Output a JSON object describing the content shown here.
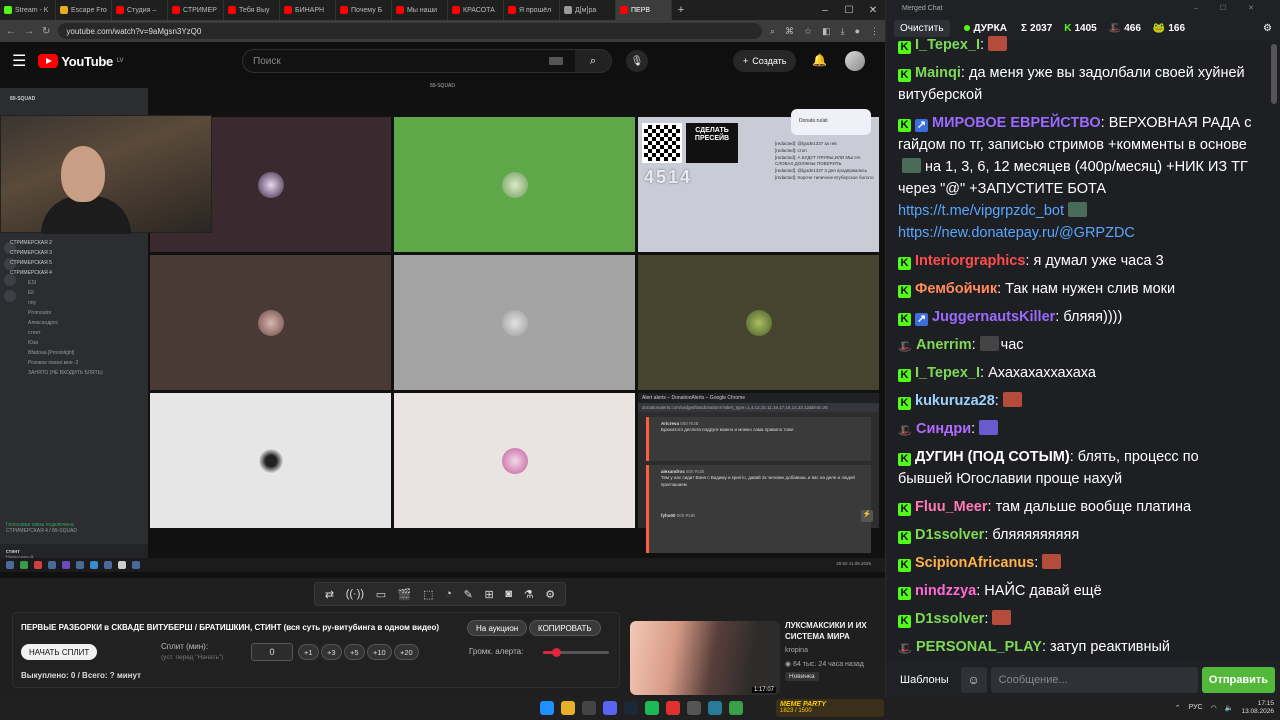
{
  "browser": {
    "tabs": [
      "Stream - K",
      "Escape Fro",
      "Студия –",
      "СТРИМЕР",
      "Тебя Выу",
      "БИНАРН",
      "Почему Б",
      "Мы наши",
      "КРАСОТА",
      "Я прошёл",
      "Д[м]ра",
      "ПЕРВ"
    ],
    "active_tab_index": 11,
    "url": "youtube.com/watch?v=9aMgsn3YzQ0"
  },
  "youtube": {
    "logo_text": "YouTube",
    "region": "LV",
    "search_placeholder": "Поиск",
    "create_label": "Создать"
  },
  "video": {
    "discord": {
      "server": "89-SQUAD",
      "channels": [
        "СТРИМЕРСКАЯ 2",
        "СТРИМЕРСКАЯ 3",
        "СТРИМЕРСКАЯ 5",
        "СТРИМЕРСКАЯ 4"
      ],
      "members": [
        "ESI",
        "Eli",
        "nny",
        "Promoutor",
        "Александрос",
        "стинт",
        "Юзи",
        "Bfadoaa [Prostolight]",
        "Розовое пиано мне -2",
        "ЗАНЯТО (НЕ ВХОДИТЬ БЛЯТЬ)"
      ],
      "status": "Голосовая связь подключена",
      "status_sub": "СТРИМЕРСКАЯ 4 / 89-SQUAD",
      "user": "стинт",
      "user_status": "Невидимый"
    },
    "tile_header": "89-SQUAD",
    "donation": {
      "donate_label": "Donate.ru/ati",
      "presave": "СДЕЛАТЬ ПРЕСЕЙВ",
      "counter": "4514",
      "chat_lines": [
        "[redacted]: @lgode1337 за гев",
        "[redacted]: стоп",
        "[redacted]: А БУДУТ ПРУФЫ,ИЛИ МЫ НА СЛОВАХ ДОЛЖНЫ ПОВЕРИТЬ",
        "[redacted]: @lgode1337 3 дня продержались",
        "[redacted]: Короче типичное втуберское болото"
      ]
    },
    "alerts": {
      "window_title": "Alert alerts – DonationAlerts – Google Chrome",
      "url": "donationalerts.com/widget/lastdonations?alert_type=1,4,13,15,11,19,17,16,14,33,12&limit=25",
      "messages": [
        {
          "name": "Aricreva",
          "amount": "500 RUB",
          "text": "Брюхатого деспота подруги можно и можно сама правило тоже"
        },
        {
          "name": "alexandros",
          "amount": "500 RUB",
          "text": "Тем у нас сидит Ваня с Вадиму и крипто, давай 2к человек добавишь и вас на деле и людей приглашаем"
        },
        {
          "name": "fyho00",
          "amount": "500 RUB",
          "text": ""
        }
      ]
    },
    "inner_clock": "20:52\n11.08.2026",
    "inner_lang": "ENG"
  },
  "controls": {
    "icons": [
      "shuffle-icon",
      "broadcast-icon",
      "card-icon",
      "clapper-icon",
      "frame-icon",
      "speed-icon",
      "pencil-icon",
      "add-screen-icon",
      "camera-icon",
      "flask-icon",
      "gear-icon"
    ]
  },
  "info_panel": {
    "title": "ПЕРВЫЕ РАЗБОРКИ в СКВАДЕ ВИТУБЕРШ / БРАТИШКИН, СТИНТ (вся суть ру-витубинга в одном видео)",
    "auction_button": "На аукцион",
    "copy_button": "КОПИРОВАТЬ",
    "split_button": "НАЧАТЬ СПЛИТ",
    "split_label": "Сплит (мин):",
    "split_hint": "(уст. перед \"Начать\")",
    "split_value": "0",
    "increments": [
      "+1",
      "+3",
      "+5",
      "+10",
      "+20"
    ],
    "alert_volume_label": "Громк. алерта:",
    "alert_volume": 0.2,
    "footer": "Выкуплено: 0 / Всего: ? минут"
  },
  "recommended": {
    "title": "ЛУКСМАКСИКИ И ИХ СИСТЕМА МИРА",
    "channel": "kropina",
    "stats": "64 тыс.  24 часа назад",
    "badge": "Новинка",
    "duration": "1:17:07"
  },
  "taskbar": {
    "meme_title": "MEME PARTY",
    "meme_sub": "1823 / 1500",
    "lang": "РУС",
    "time": "17:15",
    "date": "13.08.2026"
  },
  "chat": {
    "window_title": "Merged Chat",
    "clear_label": "Очистить",
    "live_name": "ДУРКА",
    "stats": [
      {
        "icon": "sigma-icon",
        "value": "2037"
      },
      {
        "icon": "kick-icon",
        "value": "1405"
      },
      {
        "icon": "hat-icon",
        "value": "466"
      },
      {
        "icon": "frog-icon",
        "value": "166"
      }
    ],
    "messages": [
      {
        "badge": "kick",
        "nick": "I_Tepex_I",
        "nick_color": "#7ed957",
        "text": "",
        "emote": "#b44c3b"
      },
      {
        "badge": "kick",
        "nick": "Mainqi",
        "nick_color": "#7ed957",
        "text": "да меня уже вы задолбали своей хуйней витуберской"
      },
      {
        "badge": "kick-mod",
        "nick": "МИРОВОЕ ЕВРЕЙСТВО",
        "nick_color": "#9b6bff",
        "text": "ВЕРХОВНАЯ РАДА с гайдом по тг, записью стримов +комменты в основе",
        "text2": "на 1, 3, 6, 12 месяцев (400р/месяц) +НИК ИЗ ТГ через \"@\" +ЗАПУСТИТЕ БОТА",
        "link1": "https://t.me/vipgrpzdc_bot",
        "link2": "https://new.donatepay.ru/@GRPZDC"
      },
      {
        "badge": "kick",
        "nick": "Interiorgraphics",
        "nick_color": "#ff4d4d",
        "text": "я думал уже часа 3"
      },
      {
        "badge": "kick",
        "nick": "Фембойчик",
        "nick_color": "#ff8c5a",
        "text": "Так нам нужен слив моки"
      },
      {
        "badge": "kick-mod",
        "nick": "JuggernautsKiller",
        "nick_color": "#9b6bff",
        "text": "бляяя))))"
      },
      {
        "badge": "hat",
        "nick": "Anerrim",
        "nick_color": "#7ed957",
        "text": "час",
        "emote_before": "#444"
      },
      {
        "badge": "kick",
        "nick": "I_Tepex_I",
        "nick_color": "#7ed957",
        "text": "Ахахахаххахаха"
      },
      {
        "badge": "kick",
        "nick": "kukuruza28",
        "nick_color": "#9bd2ff",
        "text": "",
        "emote": "#b44c3b"
      },
      {
        "badge": "hat",
        "nick": "Синдри",
        "nick_color": "#b06bff",
        "text": "",
        "emote": "#6a5acd"
      },
      {
        "badge": "kick",
        "nick": "ДУГИН (ПОД СОТЫМ)",
        "nick_color": "#ffffff",
        "text": "блять, процесс по бывшей Югославии проще нахуй"
      },
      {
        "badge": "kick",
        "nick": "Fluu_Meer",
        "nick_color": "#ff7ab6",
        "text": "там дальше вообще платина"
      },
      {
        "badge": "kick",
        "nick": "D1ssolver",
        "nick_color": "#7ed957",
        "text": "бляяяяяяяяя"
      },
      {
        "badge": "kick",
        "nick": "ScipionAfricanus",
        "nick_color": "#ffb347",
        "text": "",
        "emote": "#b44c3b"
      },
      {
        "badge": "kick",
        "nick": "nindzzya",
        "nick_color": "#ff6ad5",
        "text": "НАЙС давай ещё"
      },
      {
        "badge": "kick",
        "nick": "D1ssolver",
        "nick_color": "#7ed957",
        "text": "",
        "emote": "#b44c3b"
      },
      {
        "badge": "hat",
        "nick": "PERSONAL_PLAY",
        "nick_color": "#7ed957",
        "text": "затуп реактивный"
      }
    ],
    "templates_label": "Шаблоны",
    "message_placeholder": "Сообщение...",
    "send_label": "Отправить"
  }
}
